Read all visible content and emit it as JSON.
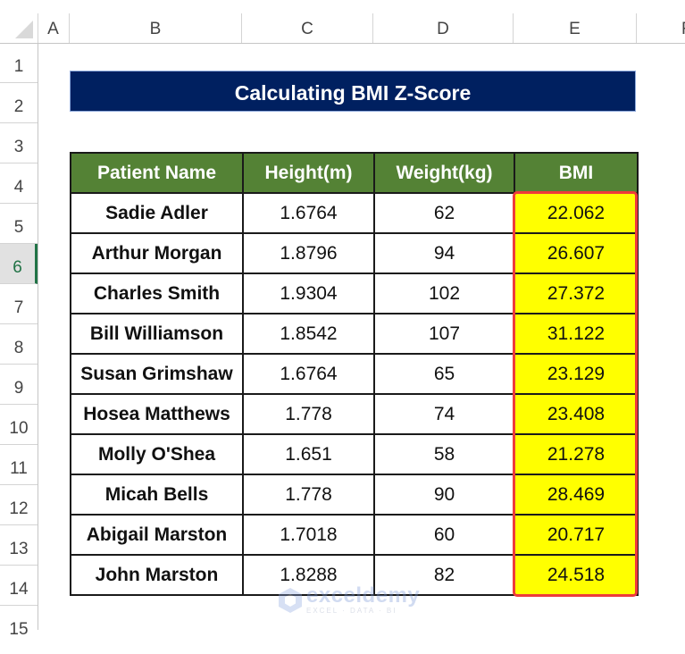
{
  "sheet": {
    "columns": [
      "A",
      "B",
      "C",
      "D",
      "E",
      "F"
    ],
    "rows": [
      "1",
      "2",
      "3",
      "4",
      "5",
      "6",
      "7",
      "8",
      "9",
      "10",
      "11",
      "12",
      "13",
      "14",
      "15"
    ],
    "selected_row": "6"
  },
  "title": "Calculating BMI Z-Score",
  "table": {
    "headers": [
      "Patient Name",
      "Height(m)",
      "Weight(kg)",
      "BMI"
    ],
    "rows": [
      {
        "name": "Sadie Adler",
        "height": "1.6764",
        "weight": "62",
        "bmi": "22.062"
      },
      {
        "name": "Arthur Morgan",
        "height": "1.8796",
        "weight": "94",
        "bmi": "26.607"
      },
      {
        "name": "Charles Smith",
        "height": "1.9304",
        "weight": "102",
        "bmi": "27.372"
      },
      {
        "name": "Bill Williamson",
        "height": "1.8542",
        "weight": "107",
        "bmi": "31.122"
      },
      {
        "name": "Susan Grimshaw",
        "height": "1.6764",
        "weight": "65",
        "bmi": "23.129"
      },
      {
        "name": "Hosea Matthews",
        "height": "1.778",
        "weight": "74",
        "bmi": "23.408"
      },
      {
        "name": "Molly O'Shea",
        "height": "1.651",
        "weight": "58",
        "bmi": "21.278"
      },
      {
        "name": "Micah Bells",
        "height": "1.778",
        "weight": "90",
        "bmi": "28.469"
      },
      {
        "name": "Abigail Marston",
        "height": "1.7018",
        "weight": "60",
        "bmi": "20.717"
      },
      {
        "name": "John Marston",
        "height": "1.8288",
        "weight": "82",
        "bmi": "24.518"
      }
    ]
  },
  "colors": {
    "title_bg": "#002060",
    "header_bg": "#548235",
    "bmi_fill": "#ffff00",
    "highlight_border": "#ee3b3b",
    "selected_row_accent": "#217346"
  },
  "watermark": {
    "brand": "exceldemy",
    "tagline": "EXCEL · DATA · BI"
  }
}
